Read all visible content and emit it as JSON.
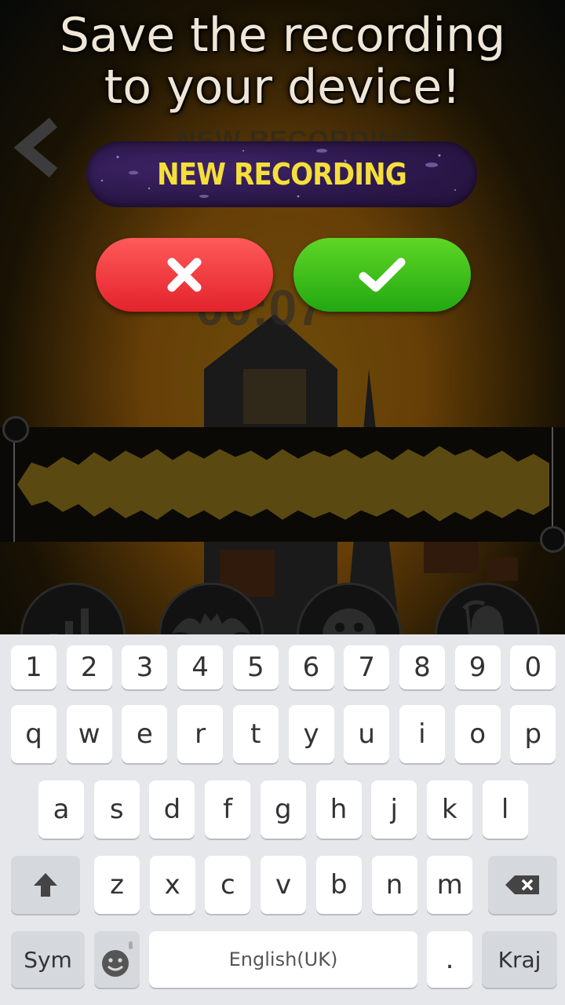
{
  "headline": {
    "line1": "Save the recording",
    "line2": "to your device!"
  },
  "ghost": {
    "title": "NEW RECORDING",
    "timer": "00:07"
  },
  "recording_name": {
    "value": "NEW RECORDING"
  },
  "actions": {
    "cancel_icon": "close-icon",
    "confirm_icon": "check-icon"
  },
  "tools": [
    {
      "icon": "equalizer-icon"
    },
    {
      "icon": "bat-icon"
    },
    {
      "icon": "monster-icon"
    },
    {
      "icon": "reaper-icon"
    }
  ],
  "keyboard": {
    "row_numbers": [
      "1",
      "2",
      "3",
      "4",
      "5",
      "6",
      "7",
      "8",
      "9",
      "0"
    ],
    "row1": [
      "q",
      "w",
      "e",
      "r",
      "t",
      "y",
      "u",
      "i",
      "o",
      "p"
    ],
    "row2": [
      "a",
      "s",
      "d",
      "f",
      "g",
      "h",
      "j",
      "k",
      "l"
    ],
    "row3": [
      "z",
      "x",
      "c",
      "v",
      "b",
      "n",
      "m"
    ],
    "sym_label": "Sym",
    "space_label": "English(UK)",
    "period_label": ".",
    "done_label": "Kraj"
  },
  "colors": {
    "accent_yellow": "#f6df3a",
    "cancel_red": "#f0333a",
    "confirm_green": "#33b81a",
    "pill_purple": "#2e1a4e"
  }
}
